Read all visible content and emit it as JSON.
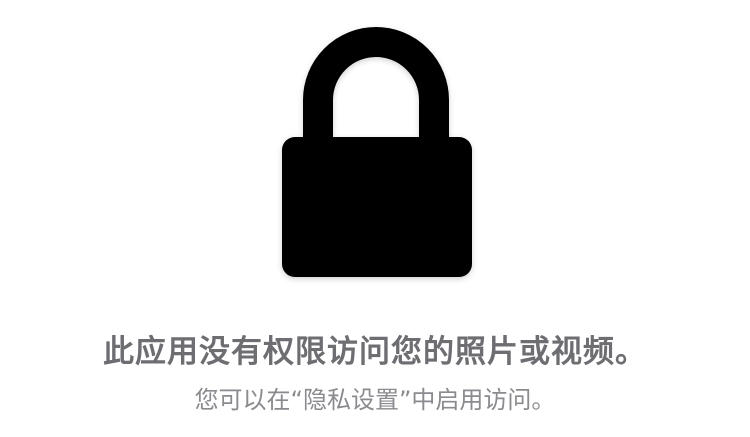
{
  "icon": "lock-icon",
  "message": {
    "title": "此应用没有权限访问您的照片或视频。",
    "subtitle": "您可以在“隐私设置”中启用访问。"
  },
  "colors": {
    "lock": "#000000",
    "title": "#6d6d72",
    "subtitle": "#8a8a8f"
  }
}
